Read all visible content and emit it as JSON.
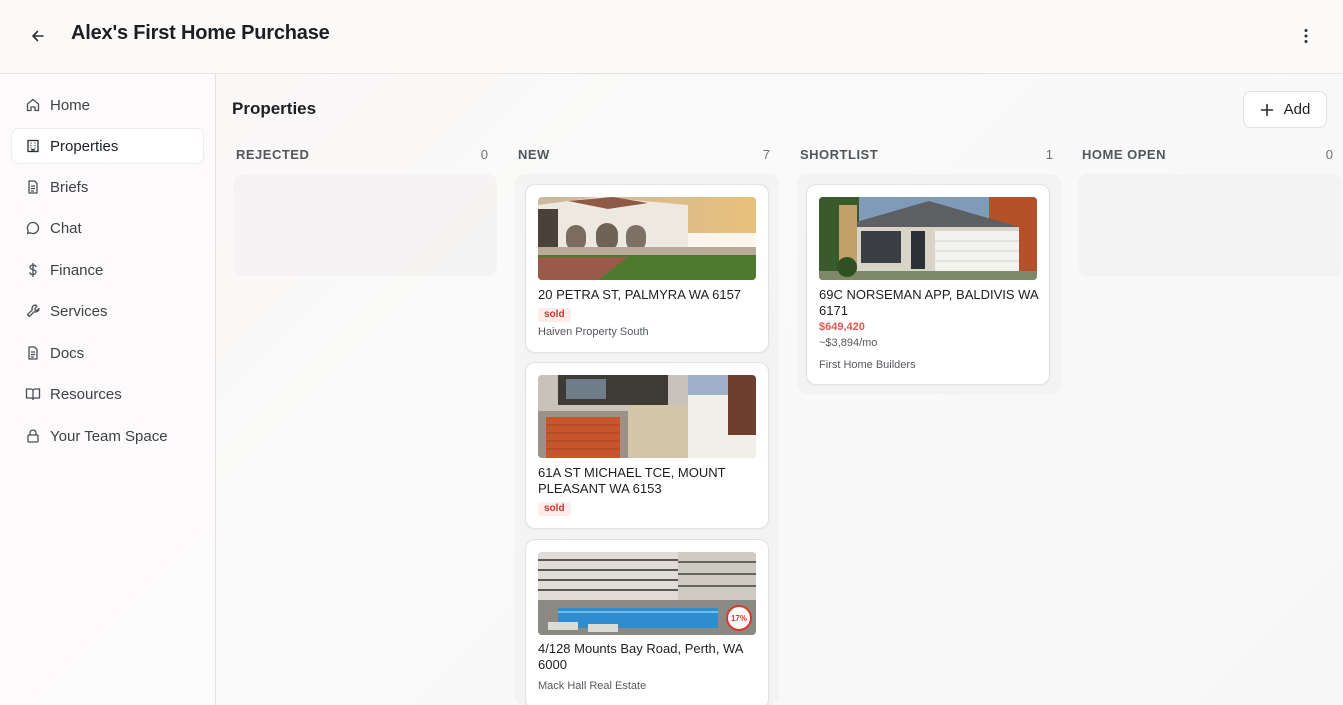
{
  "header": {
    "title": "Alex's First Home Purchase"
  },
  "sidebar": {
    "items": [
      {
        "label": "Home",
        "icon": "home-icon"
      },
      {
        "label": "Properties",
        "icon": "building-icon",
        "active": true
      },
      {
        "label": "Briefs",
        "icon": "document-icon"
      },
      {
        "label": "Chat",
        "icon": "chat-icon"
      },
      {
        "label": "Finance",
        "icon": "dollar-icon"
      },
      {
        "label": "Services",
        "icon": "wrench-icon"
      },
      {
        "label": "Docs",
        "icon": "document-icon"
      },
      {
        "label": "Resources",
        "icon": "book-icon"
      },
      {
        "label": "Your Team Space",
        "icon": "lock-icon"
      }
    ]
  },
  "main": {
    "title": "Properties",
    "add_label": "Add",
    "columns": [
      {
        "name": "REJECTED",
        "count": "0"
      },
      {
        "name": "NEW",
        "count": "7"
      },
      {
        "name": "SHORTLIST",
        "count": "1"
      },
      {
        "name": "HOME OPEN",
        "count": "0"
      }
    ],
    "cards": {
      "new": [
        {
          "address": "20 PETRA ST, PALMYRA WA 6157",
          "badge": "sold",
          "agency": "Haiven Property South"
        },
        {
          "address": "61A ST MICHAEL TCE, MOUNT PLEASANT WA 6153",
          "badge": "sold"
        },
        {
          "address": "4/128 Mounts Bay Road, Perth, WA 6000",
          "agency": "Mack Hall Real Estate",
          "percent_badge": "17%"
        }
      ],
      "shortlist": [
        {
          "address": "69C NORSEMAN APP, BALDIVIS WA 6171",
          "price": "$649,420",
          "monthly": "~$3,894/mo",
          "agency": "First Home Builders"
        }
      ]
    }
  },
  "colors": {
    "accent_red": "#e4574a",
    "sold_bg": "#fdecea",
    "sold_text": "#c8372d"
  }
}
